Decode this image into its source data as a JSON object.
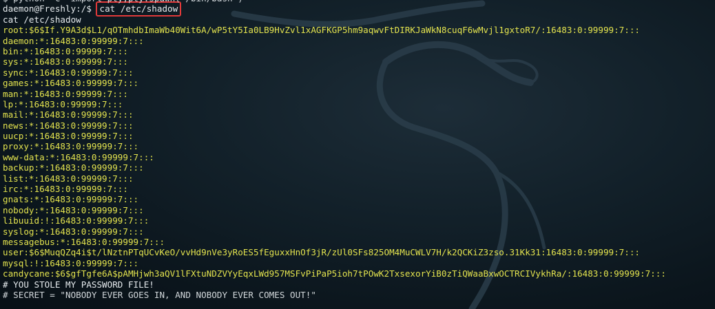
{
  "terminal": {
    "lines": [
      {
        "text": "$ python -c \"import pty;pty.spawn('/bin/bash')\"",
        "color": "light"
      },
      {
        "text": "daemon@Freshly:/$ ",
        "color": "light",
        "command": "cat /etc/shadow"
      },
      {
        "text": "cat /etc/shadow",
        "color": "light"
      },
      {
        "text": "root:$6$If.Y9A3d$L1/qOTmhdbImaWb40Wit6A/wP5tY5Ia0LB9HvZvl1xAGFKGP5hm9aqwvFtDIRKJaWkN8cuqF6wMvjl1gxtoR7/:16483:0:99999:7:::",
        "color": "yellow"
      },
      {
        "text": "daemon:*:16483:0:99999:7:::",
        "color": "yellow"
      },
      {
        "text": "bin:*:16483:0:99999:7:::",
        "color": "yellow"
      },
      {
        "text": "sys:*:16483:0:99999:7:::",
        "color": "yellow"
      },
      {
        "text": "sync:*:16483:0:99999:7:::",
        "color": "yellow"
      },
      {
        "text": "games:*:16483:0:99999:7:::",
        "color": "yellow"
      },
      {
        "text": "man:*:16483:0:99999:7:::",
        "color": "yellow"
      },
      {
        "text": "lp:*:16483:0:99999:7:::",
        "color": "yellow"
      },
      {
        "text": "mail:*:16483:0:99999:7:::",
        "color": "yellow"
      },
      {
        "text": "news:*:16483:0:99999:7:::",
        "color": "yellow"
      },
      {
        "text": "uucp:*:16483:0:99999:7:::",
        "color": "yellow"
      },
      {
        "text": "proxy:*:16483:0:99999:7:::",
        "color": "yellow"
      },
      {
        "text": "www-data:*:16483:0:99999:7:::",
        "color": "yellow"
      },
      {
        "text": "backup:*:16483:0:99999:7:::",
        "color": "yellow"
      },
      {
        "text": "list:*:16483:0:99999:7:::",
        "color": "yellow"
      },
      {
        "text": "irc:*:16483:0:99999:7:::",
        "color": "yellow"
      },
      {
        "text": "gnats:*:16483:0:99999:7:::",
        "color": "yellow"
      },
      {
        "text": "nobody:*:16483:0:99999:7:::",
        "color": "yellow"
      },
      {
        "text": "libuuid:!:16483:0:99999:7:::",
        "color": "yellow"
      },
      {
        "text": "syslog:*:16483:0:99999:7:::",
        "color": "yellow"
      },
      {
        "text": "messagebus:*:16483:0:99999:7:::",
        "color": "yellow"
      },
      {
        "text": "user:$6$MuqQZq4i$t/lNztnPTqUCvKeO/vvHd9nVe3yRoES5fEguxxHnOf3jR/zUl0SFs825OM4MuCWLV7H/k2QCKiZ3zso.31Kk31:16483:0:99999:7:::",
        "color": "yellow"
      },
      {
        "text": "mysql:!:16483:0:99999:7:::",
        "color": "yellow"
      },
      {
        "text": "candycane:$6$gfTgfe6A$pAMHjwh3aQV1lFXtuNDZVYyEqxLWd957MSFvPiPaP5ioh7tPOwK2TxsexorYiB0zTiQWaaBxwOCTRCIVykhRa/:16483:0:99999:7:::",
        "color": "yellow"
      },
      {
        "text": "# YOU STOLE MY PASSWORD FILE!",
        "color": "light"
      },
      {
        "text": "# SECRET = \"NOBODY EVER GOES IN, AND NOBODY EVER COMES OUT!\"",
        "color": "light"
      }
    ]
  },
  "colors": {
    "prompt_text": "#e6ebee",
    "output_text": "#e3e34e",
    "highlight_box": "#e23a3a",
    "background": "#122029"
  }
}
